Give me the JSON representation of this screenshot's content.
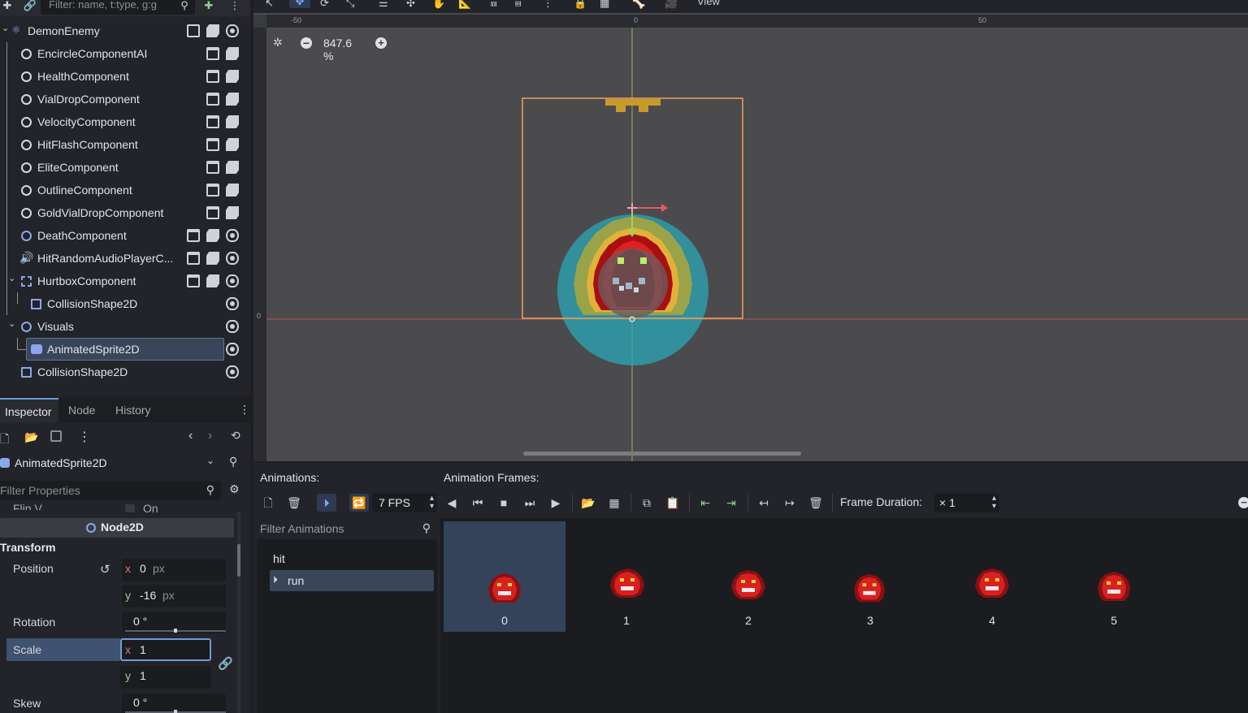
{
  "scene": {
    "filter_placeholder": "Filter: name, t:type, g:g",
    "nodes": [
      {
        "name": "DemonEnemy",
        "icon": "enemy-root-icon"
      },
      {
        "name": "EncircleComponentAI",
        "icon": "node-icon"
      },
      {
        "name": "HealthComponent",
        "icon": "node-icon"
      },
      {
        "name": "VialDropComponent",
        "icon": "node-icon"
      },
      {
        "name": "VelocityComponent",
        "icon": "node-icon"
      },
      {
        "name": "HitFlashComponent",
        "icon": "node-icon"
      },
      {
        "name": "EliteComponent",
        "icon": "node-icon"
      },
      {
        "name": "OutlineComponent",
        "icon": "node-icon"
      },
      {
        "name": "GoldVialDropComponent",
        "icon": "node-icon"
      },
      {
        "name": "DeathComponent",
        "icon": "node2d-icon"
      },
      {
        "name": "HitRandomAudioPlayerC...",
        "icon": "audio-icon"
      },
      {
        "name": "HurtboxComponent",
        "icon": "area2d-icon"
      },
      {
        "name": "CollisionShape2D",
        "icon": "collision-shape-icon"
      },
      {
        "name": "Visuals",
        "icon": "node2d-icon"
      },
      {
        "name": "AnimatedSprite2D",
        "icon": "animated-sprite-icon"
      },
      {
        "name": "CollisionShape2D",
        "icon": "collision-shape-icon"
      }
    ]
  },
  "inspector": {
    "tabs": [
      "Inspector",
      "Node",
      "History"
    ],
    "selected_node": "AnimatedSprite2D",
    "filter_placeholder": "Filter Properties",
    "flip_v_label": "Flip V",
    "flip_v_value": "On",
    "section_node2d": "Node2D",
    "group_transform": "Transform",
    "position_label": "Position",
    "position_x": "0",
    "position_y": "-16",
    "unit_px": "px",
    "rotation_label": "Rotation",
    "rotation_value": "0 °",
    "scale_label": "Scale",
    "scale_x": "1",
    "scale_y": "1",
    "skew_label": "Skew",
    "skew_value": "0 °",
    "axis_x": "x",
    "axis_y": "y"
  },
  "viewport": {
    "toolbar_view": "View",
    "zoom": "847.6 %",
    "ruler_labels": [
      "-50",
      "0",
      "50"
    ],
    "ruler_left_label": "0"
  },
  "animation": {
    "animations_title": "Animations:",
    "frames_title": "Animation Frames:",
    "fps": "7 FPS",
    "frame_duration_label": "Frame Duration:",
    "frame_duration_value": "× 1",
    "filter_placeholder": "Filter Animations",
    "list": [
      "hit",
      "run"
    ],
    "selected": "run",
    "frames": [
      "0",
      "1",
      "2",
      "3",
      "4",
      "5"
    ]
  }
}
